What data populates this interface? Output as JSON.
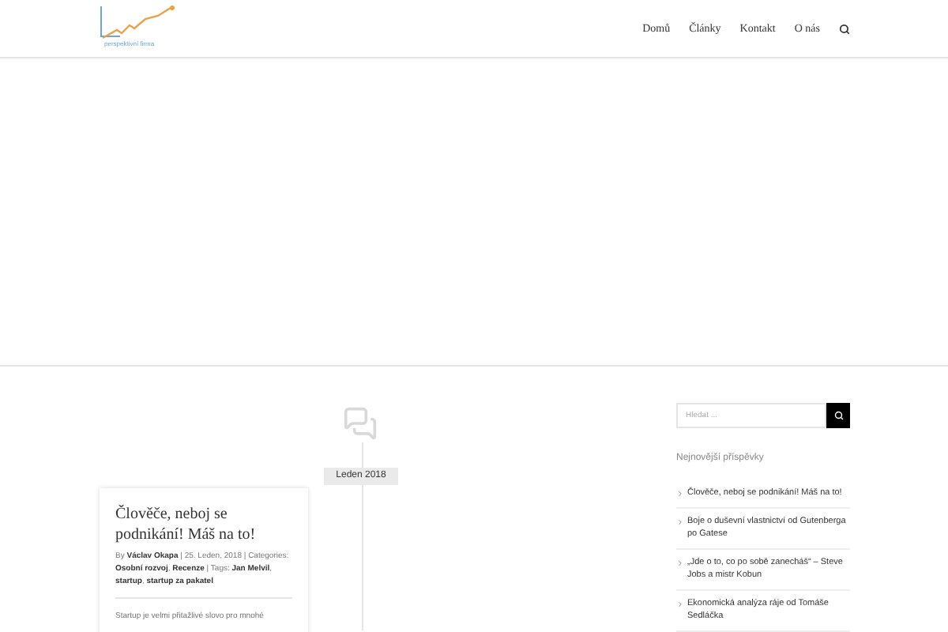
{
  "logo": {
    "text": "perspektivní firma"
  },
  "nav": [
    {
      "label": "Domů"
    },
    {
      "label": "Články"
    },
    {
      "label": "Kontakt"
    },
    {
      "label": "O nás"
    }
  ],
  "timeline": {
    "date_label": "Leden 2018"
  },
  "post": {
    "title": "Člověče, neboj se podnikání! Máš na to!",
    "meta": "By **Václav Okapa** | 25. Leden, 2018 | Categories: **Osobní rozvoj**, **Recenze** | Tags: **Jan Melvil**, **startup**, **startup za pakatel**",
    "excerpt": "Startup je velmi přitažlivé slovo pro mnohé"
  },
  "sidebar": {
    "search": {
      "placeholder": "Hledat ..."
    },
    "recent_title": "Nejnovější příspěvky",
    "recent": [
      {
        "title": "Člověče, neboj se podnikání! Máš na to!"
      },
      {
        "title": "Boje o duševní vlastnictví od Gutenberga po Gatese"
      },
      {
        "title": "„Jde o to, co po sobě zanecháš“ – Steve Jobs a mistr Kobun"
      },
      {
        "title": "Ekonomická analýza ráje od Tomáše Sedláčka"
      }
    ]
  }
}
